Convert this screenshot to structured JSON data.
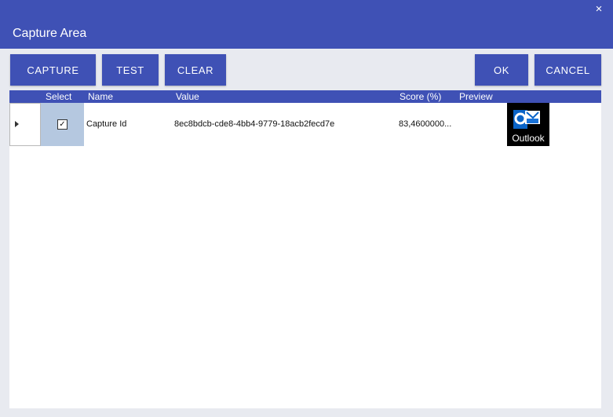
{
  "window": {
    "close_symbol": "×",
    "title": "Capture Area"
  },
  "toolbar": {
    "capture_label": "CAPTURE",
    "test_label": "TEST",
    "clear_label": "CLEAR",
    "ok_label": "OK",
    "cancel_label": "CANCEL"
  },
  "grid": {
    "columns": {
      "select": "Select",
      "name": "Name",
      "value": "Value",
      "score": "Score (%)",
      "preview": "Preview"
    },
    "rows": [
      {
        "selected": true,
        "check_mark": "✓",
        "name": "Capture Id",
        "value": "8ec8bdcb-cde8-4bb4-9779-18acb2fecd7e",
        "score": "83,4600000...",
        "preview_label": "Outlook",
        "preview_icon": "outlook-icon"
      }
    ]
  },
  "colors": {
    "accent": "#3f51b5",
    "selection": "#b5c8e0",
    "background": "#e8eaf0"
  }
}
